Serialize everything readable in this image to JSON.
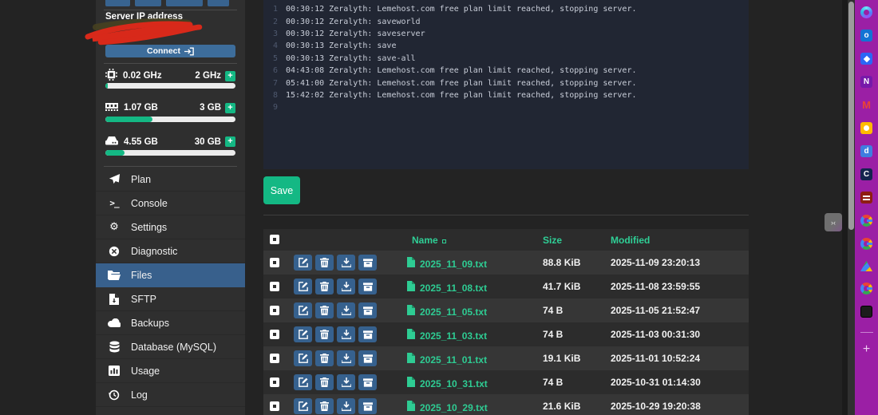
{
  "sidebar": {
    "server_ip_label": "Server IP address",
    "connect": {
      "label": "Connect"
    },
    "plus_glyph": "+",
    "meters": [
      {
        "name": "cpu",
        "used": "0.02 GHz",
        "limit": "2 GHz",
        "percent": 2
      },
      {
        "name": "memory",
        "used": "1.07 GB",
        "limit": "3 GB",
        "percent": 36
      },
      {
        "name": "storage",
        "used": "4.55 GB",
        "limit": "30 GB",
        "percent": 15
      }
    ],
    "menu": [
      {
        "label": "Plan"
      },
      {
        "label": "Console",
        "glyph": ">_"
      },
      {
        "label": "Settings",
        "glyph": "⚙"
      },
      {
        "label": "Diagnostic"
      },
      {
        "label": "Files",
        "active": true
      },
      {
        "label": "SFTP"
      },
      {
        "label": "Backups"
      },
      {
        "label": "Database (MySQL)"
      },
      {
        "label": "Usage"
      },
      {
        "label": "Log"
      }
    ]
  },
  "console_editor": {
    "lines": [
      {
        "n": "1",
        "text": "00:30:12 Zeralyth: Lemehost.com free plan limit reached, stopping server."
      },
      {
        "n": "2",
        "text": "00:30:12 Zeralyth: saveworld"
      },
      {
        "n": "3",
        "text": "00:30:12 Zeralyth: saveserver"
      },
      {
        "n": "4",
        "text": "00:30:13 Zeralyth: save"
      },
      {
        "n": "5",
        "text": "00:30:13 Zeralyth: save-all"
      },
      {
        "n": "6",
        "text": "04:43:08 Zeralyth: Lemehost.com free plan limit reached, stopping server."
      },
      {
        "n": "7",
        "text": "05:41:00 Zeralyth: Lemehost.com free plan limit reached, stopping server."
      },
      {
        "n": "8",
        "text": "15:42:02 Zeralyth: Lemehost.com free plan limit reached, stopping server."
      },
      {
        "n": "9",
        "text": ""
      }
    ]
  },
  "actions": {
    "save_label": "Save"
  },
  "files_table": {
    "headers": {
      "name": "Name",
      "size": "Size",
      "modified": "Modified"
    },
    "rows": [
      {
        "name": "2025_11_09.txt",
        "size": "88.8 KiB",
        "modified": "2025-11-09 23:20:13"
      },
      {
        "name": "2025_11_08.txt",
        "size": "41.7 KiB",
        "modified": "2025-11-08 23:59:55"
      },
      {
        "name": "2025_11_05.txt",
        "size": "74 B",
        "modified": "2025-11-05 21:52:47"
      },
      {
        "name": "2025_11_03.txt",
        "size": "74 B",
        "modified": "2025-11-03 00:31:30"
      },
      {
        "name": "2025_11_01.txt",
        "size": "19.1 KiB",
        "modified": "2025-11-01 10:52:24"
      },
      {
        "name": "2025_10_31.txt",
        "size": "74 B",
        "modified": "2025-10-31 01:14:30"
      },
      {
        "name": "2025_10_29.txt",
        "size": "21.6 KiB",
        "modified": "2025-10-29 19:20:38"
      }
    ]
  },
  "edge_bar": {
    "icons": [
      {
        "name": "copilot-icon",
        "glyph": ""
      },
      {
        "name": "outlook-icon",
        "glyph": "o"
      },
      {
        "name": "designer-icon",
        "glyph": ""
      },
      {
        "name": "onenote-icon",
        "glyph": "N"
      },
      {
        "name": "gmail-icon",
        "glyph": "M"
      },
      {
        "name": "keep-icon",
        "glyph": ""
      },
      {
        "name": "d-bookmark-icon",
        "glyph": "d"
      },
      {
        "name": "c-bookmark-icon",
        "glyph": "C"
      },
      {
        "name": "bible-icon",
        "glyph": ""
      },
      {
        "name": "google-icon",
        "glyph": ""
      },
      {
        "name": "google-icon",
        "glyph": ""
      },
      {
        "name": "drive-icon",
        "glyph": ""
      },
      {
        "name": "google-icon",
        "glyph": ""
      },
      {
        "name": "photo-icon",
        "glyph": ""
      }
    ],
    "plus_label": "+",
    "collapse_glyph": "›‹"
  },
  "colors": {
    "accent_green": "#14b884",
    "link_green": "#2ecc93",
    "header_green": "#2fcf96",
    "active_blue": "#38608c",
    "button_blue": "#36618e",
    "edge_purple": "#9b1fa5",
    "editor_bg": "#212633"
  }
}
